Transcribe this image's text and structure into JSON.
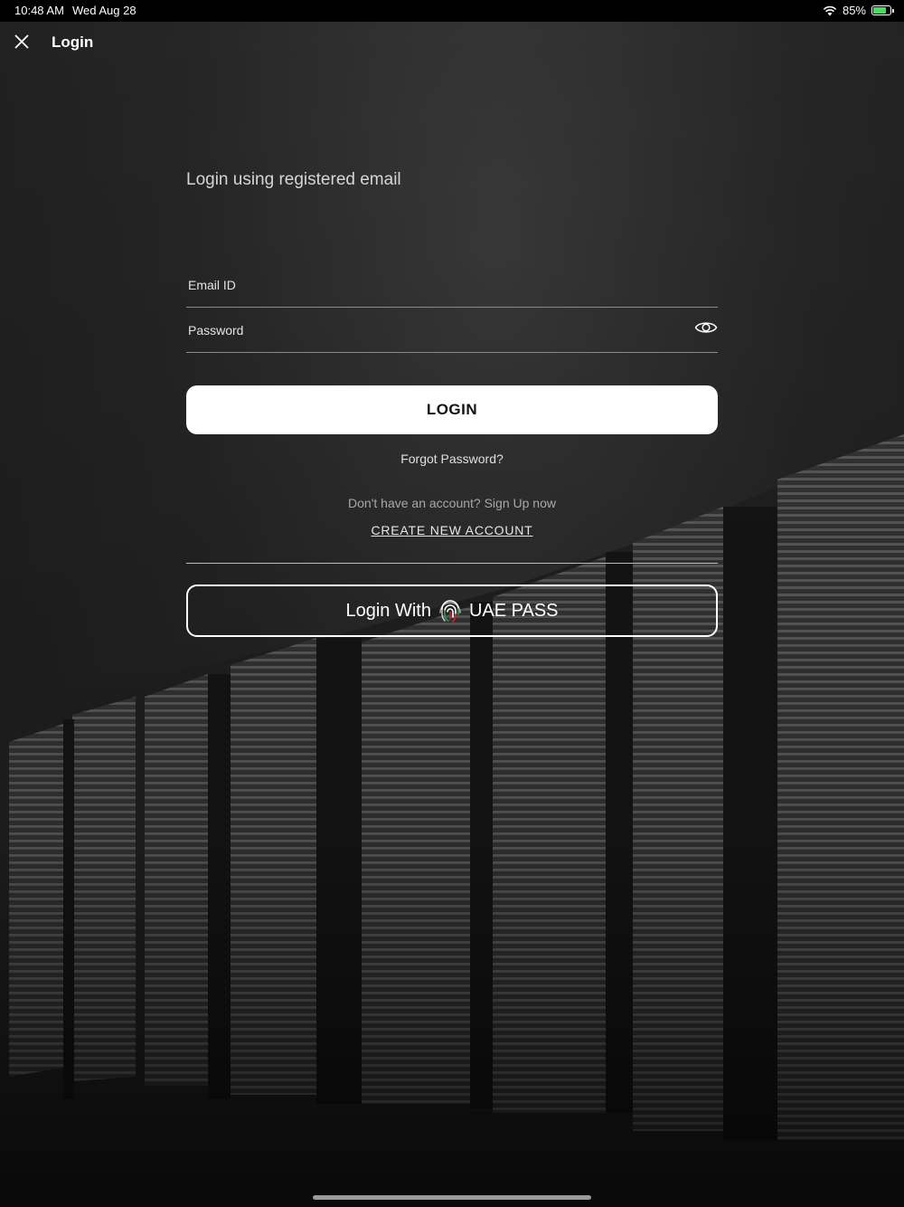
{
  "status_bar": {
    "time": "10:48 AM",
    "date": "Wed Aug 28",
    "battery": "85%",
    "battery_level": 0.85
  },
  "nav": {
    "title": "Login",
    "close_icon": "close-icon"
  },
  "form": {
    "heading": "Login using registered email",
    "email_placeholder": "Email ID",
    "password_placeholder": "Password",
    "email_value": "",
    "password_value": "",
    "eye_icon": "eye-icon"
  },
  "actions": {
    "login_label": "LOGIN",
    "forgot_password": "Forgot Password?",
    "signup_prompt": "Don't have an account? Sign Up now",
    "create_account": "CREATE NEW ACCOUNT",
    "uaepass_prefix": "Login With",
    "uaepass_suffix": "UAE PASS"
  },
  "colors": {
    "accent": "#ffffff",
    "background": "#1c1c1c",
    "battery_fill": "#4cd964"
  }
}
